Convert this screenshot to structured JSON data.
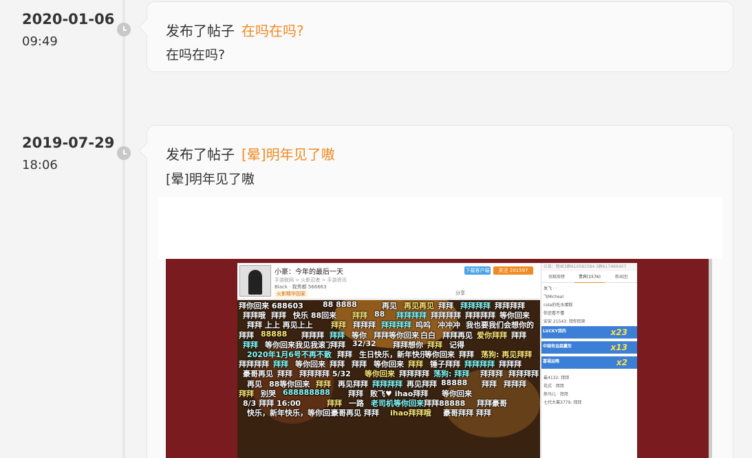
{
  "entries": [
    {
      "date": "2020-01-06",
      "time": "09:49",
      "action": "发布了帖子",
      "post_title": "在吗在吗?",
      "post_body": "在吗在吗?"
    },
    {
      "date": "2019-07-29",
      "time": "18:06",
      "action": "发布了帖子",
      "post_title": "[晕]明年见了嗷",
      "post_body": "[晕]明年见了嗷"
    }
  ],
  "screenshot": {
    "stream_title": "小豪：今年的最后一天",
    "stream_meta": "手游联网 > 火影忍者 > 手游资讯",
    "stream_meta2": "Black · 我秀都   566663",
    "stream_tag": "火影精华回家",
    "btn_follow": "关注",
    "btn_count": "201597",
    "btn_share": "分享",
    "btn_client": "下载客户端",
    "side_top": "公告：粉丝3群610581584  3群617466407",
    "side_tabs": [
      "贡献周榜",
      "贵宾(1576)",
      "粉丝团"
    ],
    "side_rows": [
      "发飞 · ·",
      "飞Micheal",
      "cola的吃水蛋糕",
      "你还看不懂",
      "安安 21543: 拜你回来",
      "最4132: 拜拜",
      "花式 · 拜拜",
      "炼马儿 · 拜拜",
      "七代大幕3779: 拜拜"
    ],
    "lucky_rows": [
      {
        "label": "LUCKY我的",
        "num": "x23"
      },
      {
        "label": "中国有运森赢车",
        "num": "x13"
      },
      {
        "label": "喜福运略",
        "num": "x2"
      }
    ],
    "danmaku": [
      "拜你回来  688603",
      "88  8888",
      "再见",
      "再见再见",
      "拜拜",
      "拜拜拜拜",
      "拜拜拜拜",
      "拜拜哦",
      "拜拜",
      "快乐  88回来",
      "拜拜",
      "88",
      "拜拜拜拜",
      "拜拜拜拜",
      "拜拜拜拜",
      "等你回来",
      "拜拜  上上  再见上上",
      "拜拜",
      "拜拜拜",
      "拜拜拜拜",
      "呜呜",
      "冲冲冲",
      "我也要我们会想你的",
      "拜拜",
      "88888",
      "拜拜拜",
      "拜拜",
      "等你",
      "拜拜等你回来",
      "白白",
      "拜拜再见",
      "爱你拜拜",
      "拜拜",
      "拜拜",
      "等你回来我见我滚了",
      "拜拜",
      "32/32",
      "拜拜想你",
      "拜拜",
      "记得",
      "2020年1月6号不再不散",
      "拜拜",
      "生日快乐，新年快乐",
      "等你回来",
      "拜拜",
      "荡狗: 再见拜拜",
      "拜拜拜拜",
      "拜拜",
      "等你回来",
      "拜拜",
      "拜拜",
      "等你回来",
      "拜拜",
      "锤子拜拜",
      "拜拜拜拜",
      "拜拜拜",
      "豪哥再见",
      "拜拜",
      "拜拜拜拜 5/32",
      "等你回来",
      "拜拜拜拜",
      "荡狗: 拜拜",
      "拜拜拜",
      "拜拜拜拜",
      "再见",
      "88等你回来",
      "拜拜",
      "再见拜拜",
      "拜拜拜拜",
      "再见拜拜",
      "88888",
      "拜拜",
      "拜拜拜",
      "拜拜",
      "别哭",
      "688888888",
      "拜拜",
      "败飞♥ ihao拜拜",
      "等你回来",
      "8/3 拜拜 16:00",
      "拜拜",
      "一路",
      "老司机等你回来",
      "拜拜88888",
      "拜拜豪哥",
      "快乐，新年快乐，等你回来",
      "豪哥再见  拜拜",
      "ihao拜拜哦",
      "豪哥拜拜  拜拜"
    ]
  }
}
